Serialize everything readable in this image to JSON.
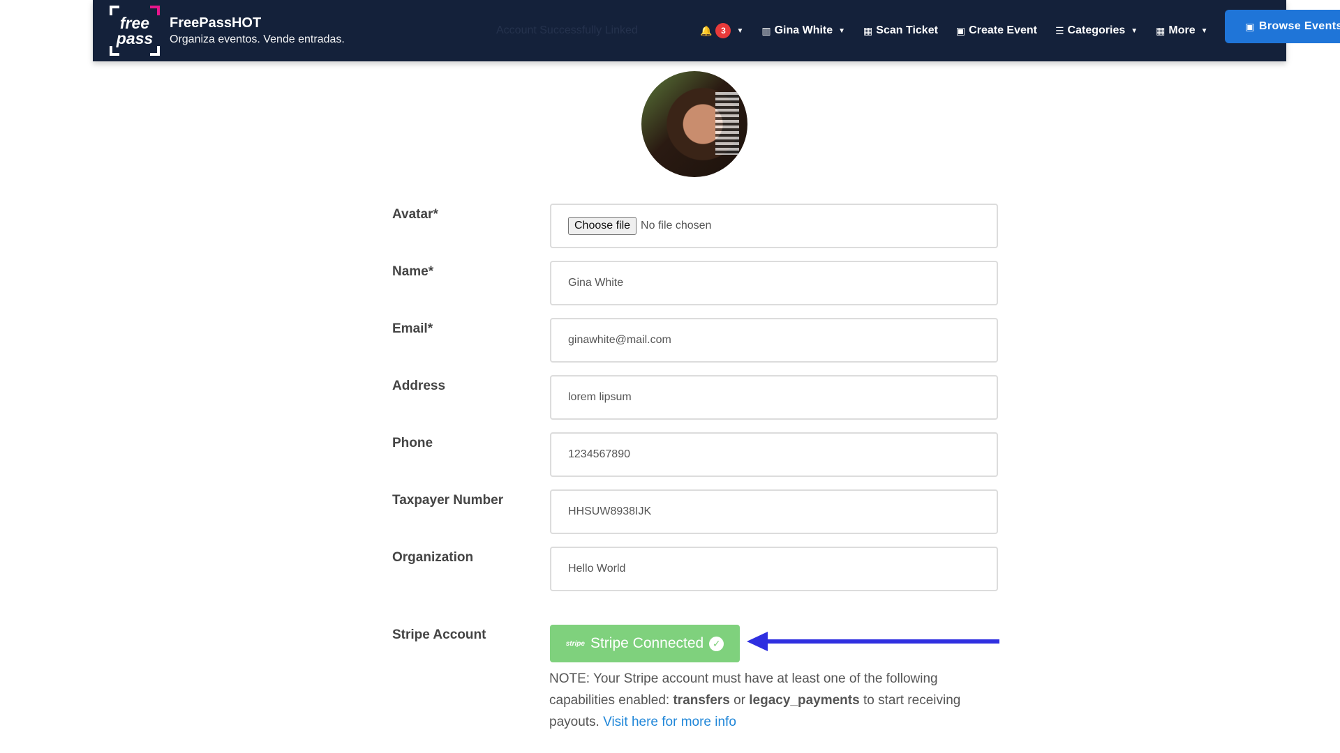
{
  "brand": {
    "logo_line1": "free",
    "logo_line2": "pass",
    "name": "FreePassHOT",
    "tagline": "Organiza eventos. Vende entradas."
  },
  "navbar": {
    "ghost_text": "Account Successfully Linked",
    "notifications_count": "3",
    "user_name": "Gina White",
    "scan_ticket": "Scan Ticket",
    "create_event": "Create Event",
    "categories": "Categories",
    "more": "More",
    "browse_events": "Browse Events"
  },
  "form": {
    "avatar_label": "Avatar*",
    "choose_file": "Choose file",
    "no_file": "No file chosen",
    "name_label": "Name*",
    "name_value": "Gina White",
    "email_label": "Email*",
    "email_value": "ginawhite@mail.com",
    "address_label": "Address",
    "address_value": "lorem lipsum",
    "phone_label": "Phone",
    "phone_value": "1234567890",
    "taxpayer_label": "Taxpayer Number",
    "taxpayer_value": "HHSUW8938IJK",
    "organization_label": "Organization",
    "organization_value": "Hello World",
    "stripe_label": "Stripe Account",
    "stripe_logo": "stripe",
    "stripe_button": "Stripe Connected"
  },
  "note": {
    "prefix": "NOTE: Your Stripe account must have at least one of the following capabilities enabled: ",
    "cap1": "transfers",
    "or": " or ",
    "cap2": "legacy_payments",
    "suffix": " to start receiving payouts. ",
    "link": "Visit here for more info"
  },
  "colors": {
    "navbar_bg": "#14213a",
    "browse_button": "#1f75d8",
    "stripe_green": "#7fd17d",
    "arrow_blue": "#2f2fe0",
    "link_blue": "#1f86d8",
    "badge_red": "#e83a3a"
  },
  "icons": [
    "bell-icon",
    "user-building-icon",
    "qr-icon",
    "calendar-plus-icon",
    "list-icon",
    "grid-icon",
    "calendar-icon",
    "check-circle-icon",
    "caret-down-icon"
  ]
}
